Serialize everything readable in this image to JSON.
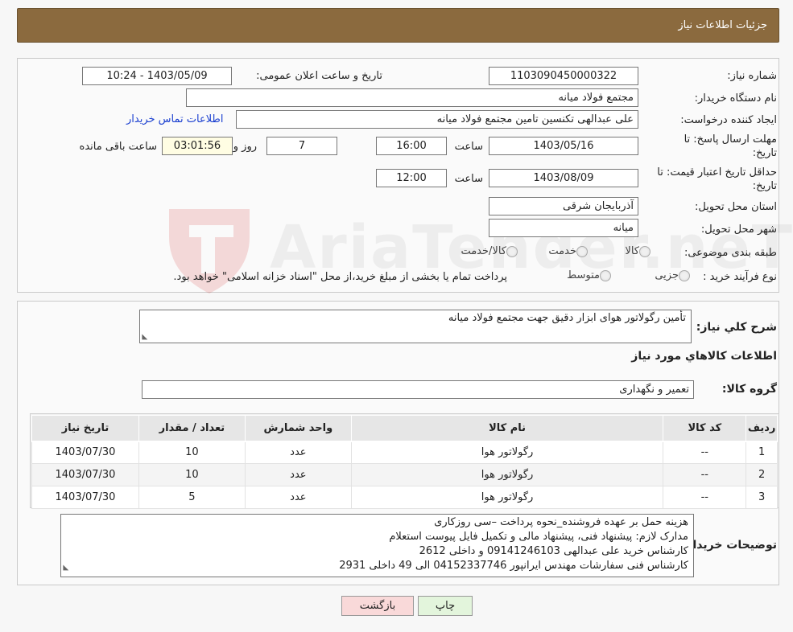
{
  "header": {
    "title": "جزئیات اطلاعات نیاز"
  },
  "fields": {
    "need_number_label": "شماره نیاز:",
    "need_number": "1103090450000322",
    "announce_label": "تاریخ و ساعت اعلان عمومی:",
    "announce_value": "1403/05/09 - 10:24",
    "buyer_org_label": "نام دستگاه خریدار:",
    "buyer_org": "مجتمع فولاد میانه",
    "requester_label": "ایجاد کننده درخواست:",
    "requester": "علی عبدالهی تکنسین تامین مجتمع فولاد میانه",
    "contact_link": "اطلاعات تماس خریدار",
    "deadline_label_1": "مهلت ارسال پاسخ: تا",
    "deadline_label_2": "تاریخ:",
    "deadline_date": "1403/05/16",
    "time_label": "ساعت",
    "deadline_time": "16:00",
    "days_value": "7",
    "days_label": "روز و",
    "remaining_value": "03:01:56",
    "remaining_label": "ساعت باقی مانده",
    "validity_label_1": "حداقل تاریخ اعتبار قیمت: تا",
    "validity_label_2": "تاریخ:",
    "validity_date": "1403/08/09",
    "validity_time": "12:00",
    "province_label": "استان محل تحویل:",
    "province": "آذربایجان شرقی",
    "city_label": "شهر محل تحویل:",
    "city": "میانه",
    "category_label": "طبقه بندی موضوعی:",
    "category_options": [
      "کالا",
      "خدمت",
      "کالا/خدمت"
    ],
    "purchase_type_label": "نوع فرآیند خرید :",
    "purchase_options": [
      "جزیی",
      "متوسط"
    ],
    "purchase_note": "پرداخت تمام یا بخشی از مبلغ خرید،از محل \"اسناد خزانه اسلامی\" خواهد بود."
  },
  "summary": {
    "desc_label": "شرح کلي نياز:",
    "desc_value": "تأمین رگولاتور هوای ابزار دقیق جهت مجتمع فولاد میانه",
    "goods_title": "اطلاعات کالاهاي مورد نياز",
    "group_label": "گروه کالا:",
    "group_value": "تعمیر و نگهداری"
  },
  "table": {
    "headers": [
      "ردیف",
      "کد کالا",
      "نام کالا",
      "واحد شمارش",
      "تعداد / مقدار",
      "تاریخ نیاز"
    ],
    "rows": [
      [
        "1",
        "--",
        "رگولاتور هوا",
        "عدد",
        "10",
        "1403/07/30"
      ],
      [
        "2",
        "--",
        "رگولاتور هوا",
        "عدد",
        "10",
        "1403/07/30"
      ],
      [
        "3",
        "--",
        "رگولاتور هوا",
        "عدد",
        "5",
        "1403/07/30"
      ]
    ]
  },
  "buyer_notes": {
    "label": "توضیحات خریدار:",
    "lines": [
      "هزینه حمل بر عهده فروشنده_نحوه پرداخت –سی روزکاری",
      "مدارک لازم: پیشنهاد فنی، پیشنهاد مالی و تکمیل فایل پیوست استعلام",
      "کارشناس خرید علی عبدالهی 09141246103 و داخلی 2612",
      "کارشناس فنی سفارشات مهندس ایرانپور 04152337746 الی 49 داخلی 2931"
    ]
  },
  "buttons": {
    "print": "چاپ",
    "back": "بازگشت"
  },
  "watermark": {
    "text": "AriaTender.neT"
  },
  "colors": {
    "header_bg": "#8b6a3e",
    "link": "#1a3fd0",
    "back_button_bg": "#f9d9d9",
    "print_button_bg": "#e3f5dc"
  }
}
